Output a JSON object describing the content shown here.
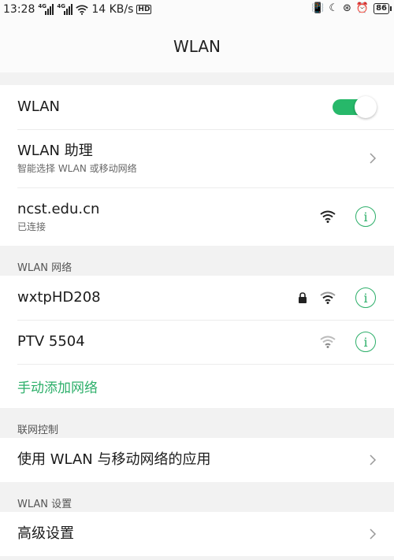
{
  "status_bar": {
    "time": "13:28",
    "signal1_tag": "4G",
    "signal2_tag": "4G",
    "net_speed": "14 KB/s",
    "hd_label": "HD",
    "battery": "86",
    "icons": [
      "signal-icon",
      "signal-icon",
      "wifi-icon",
      "hd-icon",
      "vibrate-icon",
      "moon-icon",
      "lock-rotation-icon",
      "alarm-icon",
      "battery-icon"
    ]
  },
  "header": {
    "title": "WLAN"
  },
  "wlan_toggle": {
    "label": "WLAN",
    "enabled": true
  },
  "assistant": {
    "title": "WLAN 助理",
    "subtitle": "智能选择 WLAN 或移动网络"
  },
  "connected": {
    "ssid": "ncst.edu.cn",
    "status": "已连接"
  },
  "sections": {
    "networks": "WLAN 网络",
    "network_control": "联网控制",
    "wlan_settings": "WLAN 设置"
  },
  "networks": [
    {
      "ssid": "wxtpHD208",
      "secured": true
    },
    {
      "ssid": "PTV 5504",
      "secured": false
    }
  ],
  "add_network": "手动添加网络",
  "apps_using": "使用 WLAN 与移动网络的应用",
  "advanced": "高级设置",
  "colors": {
    "accent": "#2daf6a",
    "toggle_on": "#27b86a",
    "background": "#f2f2f2"
  }
}
